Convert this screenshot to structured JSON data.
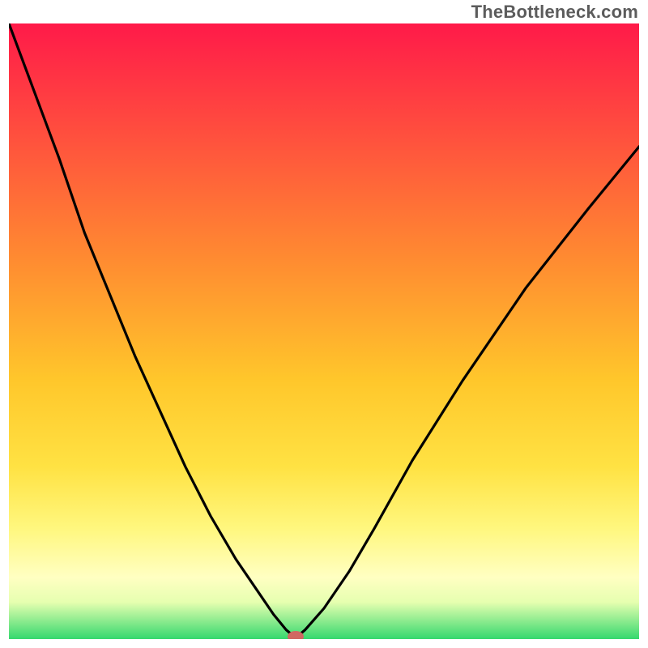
{
  "attribution": "TheBottleneck.com",
  "chart_data": {
    "type": "line",
    "title": "",
    "xlabel": "",
    "ylabel": "",
    "xlim": [
      0,
      100
    ],
    "ylim": [
      0,
      100
    ],
    "background": "gradient red-yellow-green (top to bottom)",
    "series": [
      {
        "name": "bottleneck-curve",
        "x": [
          0,
          4,
          8,
          12,
          16,
          20,
          24,
          28,
          32,
          36,
          40,
          42,
          44,
          45.5,
          47,
          50,
          54,
          58,
          64,
          72,
          82,
          92,
          100
        ],
        "y": [
          100,
          89,
          78,
          66,
          56,
          46,
          37,
          28,
          20,
          13,
          7,
          4,
          1.5,
          0.2,
          1.5,
          5,
          11,
          18,
          29,
          42,
          57,
          70,
          80
        ]
      }
    ],
    "annotations": [
      {
        "name": "optimum-marker",
        "x": 45.5,
        "y": 0.4,
        "shape": "ellipse"
      }
    ]
  }
}
